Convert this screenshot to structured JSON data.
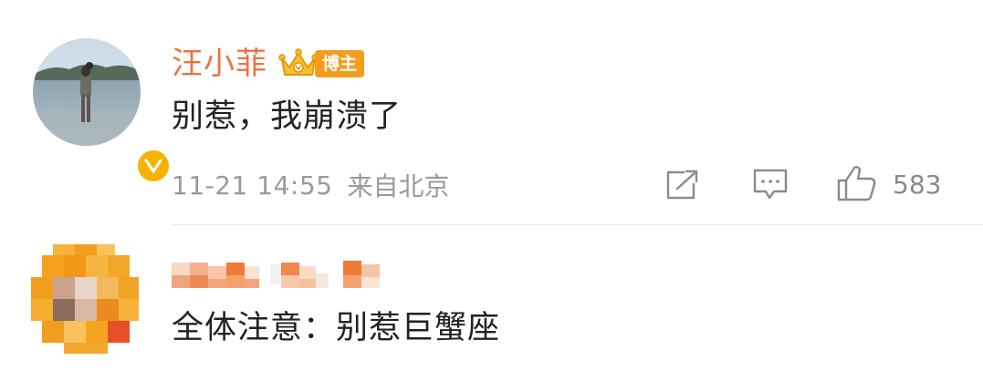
{
  "comments": [
    {
      "username": "汪小菲",
      "badge_label": "博主",
      "text": "别惹，我崩溃了",
      "time": "11-21 14:55",
      "source": "来自北京",
      "like_count": "583",
      "verified": true
    },
    {
      "username_censored": true,
      "text": "全体注意：别惹巨蟹座"
    }
  ],
  "icons": {
    "share": "share-icon",
    "comment": "comment-icon",
    "like": "thumbs-up-icon",
    "verified": "verified-v-icon",
    "crown": "crown-icon"
  },
  "colors": {
    "username": "#eb7340",
    "badge": "#f29d1e",
    "verified": "#f7b200",
    "meta": "#9a9a9a",
    "text": "#222222"
  }
}
